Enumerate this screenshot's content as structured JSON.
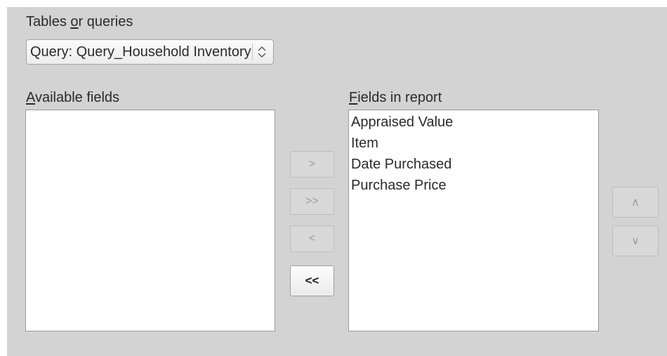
{
  "tables_label": {
    "prefix": "Tables ",
    "mnemonic": "o",
    "suffix": "r queries"
  },
  "source_select": {
    "value": "Query: Query_Household Inventory"
  },
  "available_fields": {
    "label": {
      "mnemonic": "A",
      "rest": "vailable fields"
    },
    "items": []
  },
  "fields_in_report": {
    "label": {
      "mnemonic": "F",
      "rest": "ields in report"
    },
    "items": [
      "Appraised Value",
      "Item",
      "Date Purchased",
      "Purchase Price"
    ]
  },
  "transfer_buttons": {
    "add_one": ">",
    "add_all": ">>",
    "remove_one": "<",
    "remove_all": "<<"
  },
  "order_buttons": {
    "move_up": "∧",
    "move_down": "∨"
  }
}
